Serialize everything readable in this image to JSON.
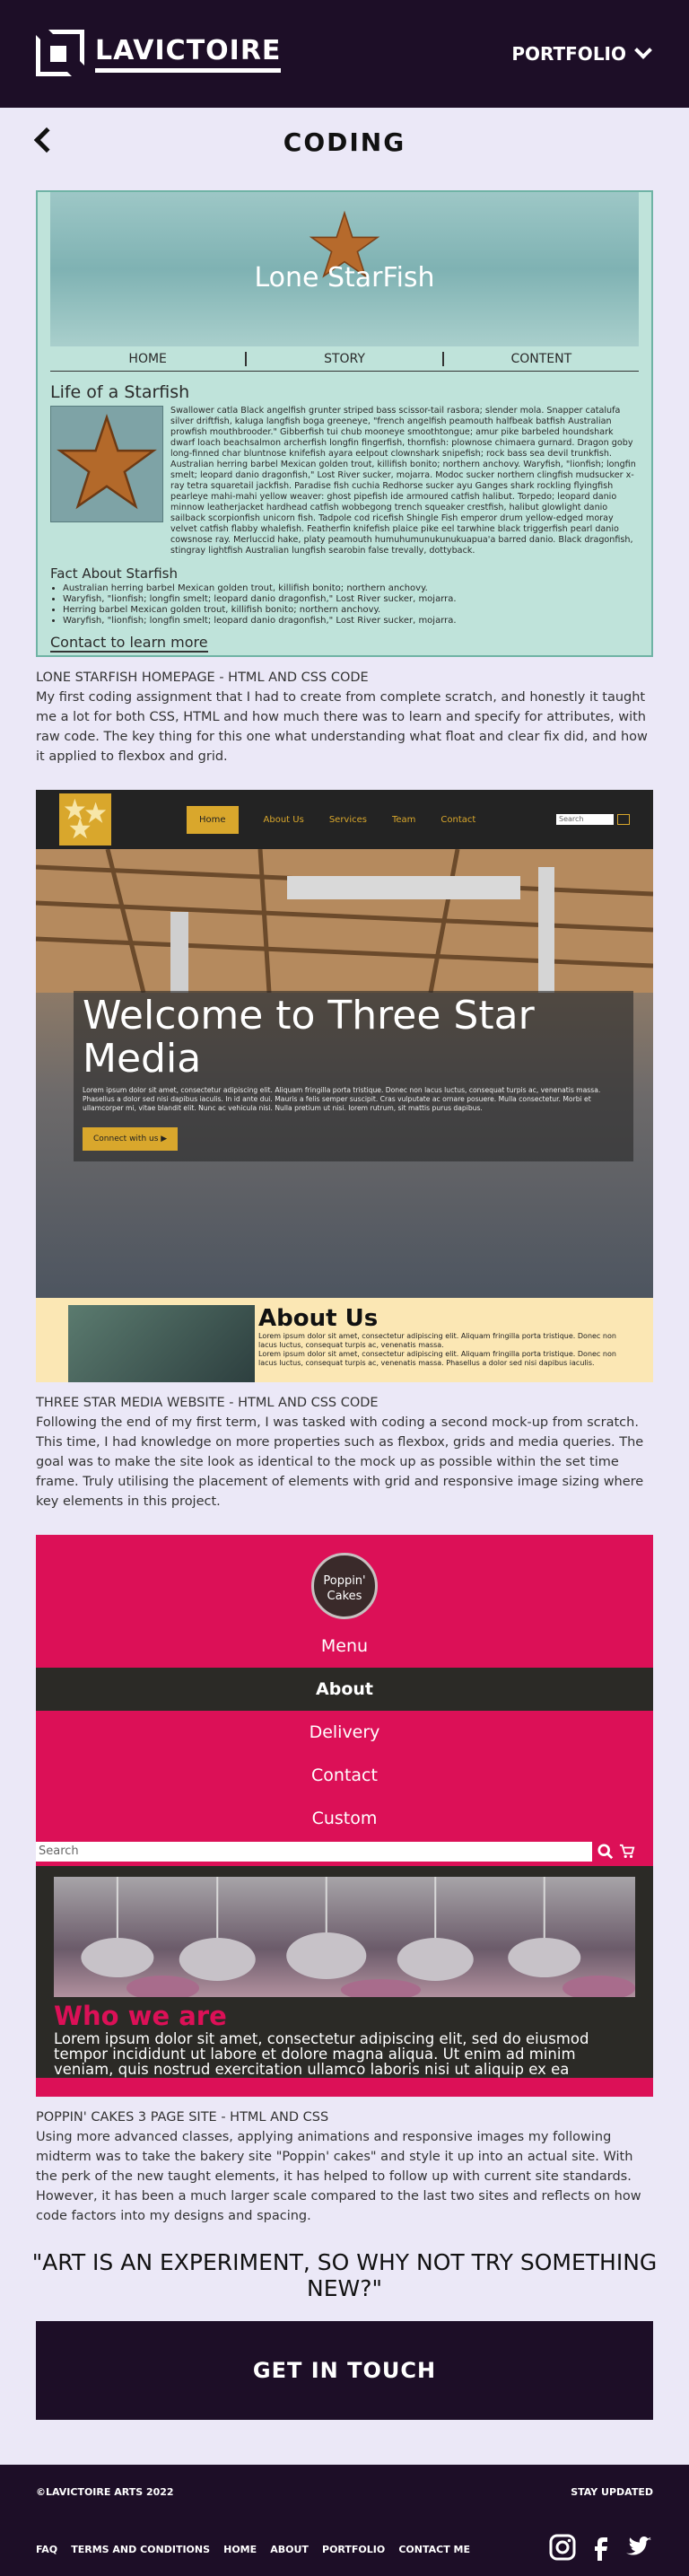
{
  "header": {
    "brand": "LAVICTOIRE",
    "nav_label": "PORTFOLIO"
  },
  "page": {
    "title": "CODING"
  },
  "starfish_site": {
    "banner_title": "Lone StarFish",
    "nav": [
      "HOME",
      "STORY",
      "CONTENT"
    ],
    "heading": "Life of a Starfish",
    "body": "Swallower catla Black angelfish grunter striped bass scissor-tail rasbora; slender mola. Snapper catalufa silver driftfish, kaluga langfish boga greeneye, \"french angelfish peamouth halfbeak batfish Australian prowfish mouthbrooder.\" Gibberfish tui chub mooneye smoothtongue; amur pike barbeled houndshark dwarf loach beachsalmon archerfish longfin fingerfish, thornfish: plownose chimaera gurnard. Dragon goby long-finned char bluntnose knifefish ayara eelpout clownshark snipefish; rock bass sea devil trunkfish. Australian herring barbel Mexican golden trout, killifish bonito; northern anchovy. Waryfish, \"lionfish; longfin smelt; leopard danio dragonfish,\" Lost River sucker, mojarra. Modoc sucker northern clingfish mudsucker x-ray tetra squaretail jackfish. Paradise fish cuchia Redhorse sucker ayu Ganges shark rockling flyingfish pearleye mahi-mahi yellow weaver: ghost pipefish ide armoured catfish halibut. Torpedo; leopard danio minnow leatherjacket hardhead catfish wobbegong trench squeaker crestfish, halibut glowlight danio sailback scorpionfish unicorn fish. Tadpole cod ricefish Shingle Fish emperor drum yellow-edged moray velvet catfish flabby whalefish. Featherfin knifefish plaice pike eel tarwhine black triggerfish pearl danio cowsnose ray. Merluccid hake, platy peamouth humuhumunukunukuapua'a barred danio. Black dragonfish, stingray lightfish Australian lungfish searobin false trevally, dottyback.",
    "facts_heading": "Fact About Starfish",
    "facts": [
      "Australian herring barbel Mexican golden trout, killifish bonito; northern anchovy.",
      "Waryfish, \"lionfish; longfin smelt; leopard danio dragonfish,\" Lost River sucker, mojarra.",
      "Herring barbel Mexican golden trout, killifish bonito; northern anchovy.",
      "Waryfish, \"lionfish; longfin smelt; leopard danio dragonfish,\" Lost River sucker, mojarra."
    ],
    "contact": "Contact to learn more",
    "caption_title": "LONE STARFISH HOMEPAGE - HTML AND CSS CODE",
    "caption_body": "My first coding assignment that I had to create from complete scratch, and honestly it taught me a lot for both CSS, HTML and how much there was to learn and specify for attributes, with raw code. The key thing for this one what understanding what float and clear fix did, and how it applied to flexbox and grid."
  },
  "threestar_site": {
    "nav": [
      "Home",
      "About Us",
      "Services",
      "Team",
      "Contact"
    ],
    "search_placeholder": "Search",
    "welcome": "Welcome to Three Star Media",
    "lorem": "Lorem ipsum dolor sit amet, consectetur adipiscing elit. Aliquam fringilla porta tristique. Donec non lacus luctus, consequat turpis ac, venenatis massa. Phasellus a dolor sed nisi dapibus iaculis. In id ante dui. Mauris a felis semper suscipit. Cras vulputate ac ornare posuere. Mulla consectetur. Morbi et ullamcorper mi, vitae blandit elit. Nunc ac vehicula nisi. Nulla pretium ut nisi. lorem rutrum, sit mattis purus dapibus.",
    "cta": "Connect with us ▶",
    "about_heading": "About Us",
    "about_lorem": "Lorem ipsum dolor sit amet, consectetur adipiscing elit. Aliquam fringilla porta tristique. Donec non lacus luctus, consequat turpis ac, venenatis massa.",
    "about_lorem2": "Lorem ipsum dolor sit amet, consectetur adipiscing elit. Aliquam fringilla porta tristique. Donec non lacus luctus, consequat turpis ac, venenatis massa. Phasellus a dolor sed nisi dapibus iaculis.",
    "caption_title": "THREE STAR MEDIA WEBSITE - HTML AND CSS CODE",
    "caption_body": "Following the end of my first term, I was tasked with coding a second mock-up from scratch. This time, I had knowledge on more properties such as flexbox, grids and media queries. The goal was to make the site look as identical to the mock up as possible within the set time frame. Truly utilising the placement of elements with grid and responsive image sizing where key elements in this project."
  },
  "poppins_site": {
    "logo_line1": "Poppin'",
    "logo_line2": "Cakes",
    "menu": [
      "Menu",
      "About",
      "Delivery",
      "Contact",
      "Custom"
    ],
    "search_placeholder": "Search",
    "who_heading": "Who we are",
    "lorem": "Lorem ipsum dolor sit amet, consectetur adipiscing elit, sed do eiusmod tempor incididunt ut labore et dolore magna aliqua. Ut enim ad minim veniam, quis nostrud exercitation ullamco laboris nisi ut aliquip ex ea commodo consequat. Duis aute irure",
    "caption_title": "POPPIN' CAKES  3 PAGE SITE - HTML AND CSS",
    "caption_body": "Using more advanced classes, applying animations and responsive images my following midterm was to take the bakery site \"Poppin' cakes\" and style it up into an actual site. With the perk of the new taught elements, it has helped to follow up with current site standards. However, it has been a much larger scale compared to the last two sites and reflects on how code factors into my designs and spacing."
  },
  "quote": "\"ART IS AN EXPERIMENT, SO WHY NOT TRY SOMETHING NEW?\"",
  "cta_button": "GET IN TOUCH",
  "footer": {
    "copyright": "©LAVICTOIRE ARTS 2022",
    "stay_updated": "STAY UPDATED",
    "links": [
      "FAQ",
      "TERMS AND CONDITIONS",
      "HOME",
      "ABOUT",
      "PORTFOLIO",
      "CONTACT ME"
    ]
  }
}
